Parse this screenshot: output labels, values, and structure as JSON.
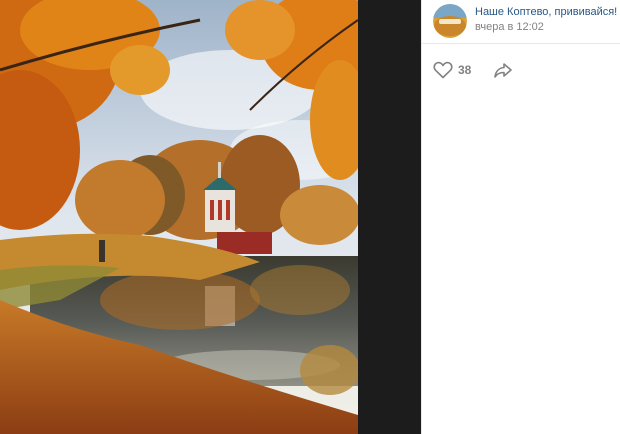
{
  "post": {
    "group_name": "Наше Коптево, прививайся!",
    "time": "вчера в 12:02",
    "likes": "38"
  },
  "icons": {
    "like": "heart-icon",
    "share": "share-arrow-icon"
  },
  "colors": {
    "link": "#2a5885",
    "meta": "#828282",
    "viewer_background": "#1c1c1c"
  }
}
